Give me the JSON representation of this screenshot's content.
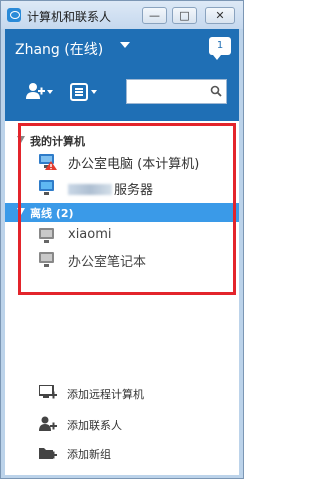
{
  "window": {
    "title": "计算机和联系人",
    "controls": {
      "minimize": "—",
      "maximize": "□",
      "close": "✕"
    }
  },
  "header": {
    "user_name": "Zhang (在线)",
    "message_count": "1",
    "search": {
      "placeholder": "",
      "value": ""
    }
  },
  "groups": [
    {
      "label": "我的计算机",
      "items": [
        {
          "label": "办公室电脑 (本计算机)",
          "icon": "computer-warning-icon"
        },
        {
          "label": "服务器",
          "icon": "computer-online-icon"
        }
      ]
    },
    {
      "label": "离线 (2)",
      "items": [
        {
          "label": "xiaomi",
          "icon": "computer-offline-icon"
        },
        {
          "label": "办公室笔记本",
          "icon": "computer-offline-icon"
        }
      ]
    }
  ],
  "actions": [
    {
      "label": "添加远程计算机",
      "icon": "add-computer-icon"
    },
    {
      "label": "添加联系人",
      "icon": "add-contact-icon"
    },
    {
      "label": "添加新组",
      "icon": "add-group-icon"
    }
  ],
  "colors": {
    "header_blue": "#1f6fb5",
    "selected_group": "#3a9ae8",
    "highlight_frame": "#e3242b"
  }
}
